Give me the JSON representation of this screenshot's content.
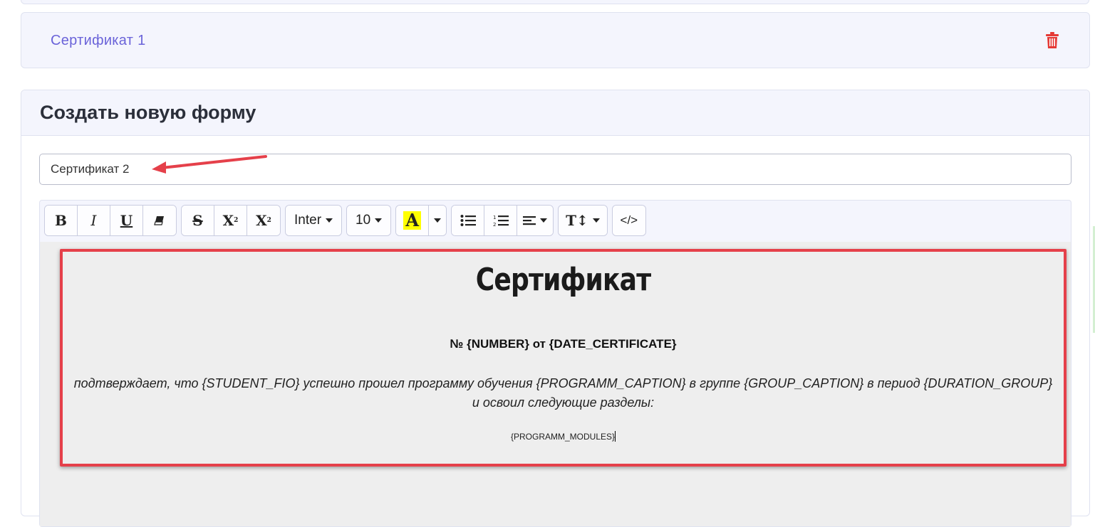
{
  "existing_forms": {
    "items": [
      {
        "label": "Сертификат 1"
      }
    ]
  },
  "create_form": {
    "title": "Создать новую форму",
    "name_value": "Сертификат 2"
  },
  "toolbar": {
    "bold": "B",
    "italic": "I",
    "underline": "U",
    "strike": "S",
    "superscript": "X",
    "superscript_mark": "2",
    "subscript": "X",
    "subscript_mark": "2",
    "font_family": "Inter",
    "font_size": "10",
    "highlight": "A",
    "highlight_color": "#ffff00",
    "line_height": "T↕",
    "code": "</>"
  },
  "document": {
    "title": "Сертификат",
    "number_line": "№ {NUMBER} от {DATE_CERTIFICATE}",
    "body_text": "подтверждает, что {STUDENT_FIO} успешно прошел программу обучения {PROGRAMM_CAPTION} в группе {GROUP_CAPTION} в период {DURATION_GROUP} и освоил следующие разделы:",
    "modules": "{PROGRAMM_MODULES}"
  },
  "colors": {
    "accent": "#6a63d9",
    "danger": "#e53935",
    "annotation": "#e5404a"
  }
}
